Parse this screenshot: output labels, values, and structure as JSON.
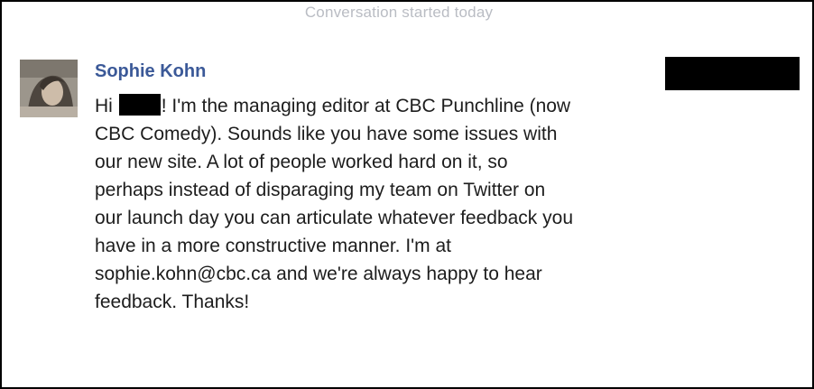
{
  "conversation": {
    "header": "Conversation started today"
  },
  "message": {
    "sender": "Sophie Kohn",
    "greeting": "Hi",
    "lines": {
      "l1_rest": "! I'm the managing editor at CBC Punchline (now",
      "l2": "CBC Comedy). Sounds like you have some issues with",
      "l3": "our new site. A lot of people worked hard on it, so",
      "l4": "perhaps instead of disparaging my team on Twitter on",
      "l5": "our launch day you can articulate whatever feedback you",
      "l6": "have in a more constructive manner. I'm at",
      "l7": "sophie.kohn@cbc.ca and we're always happy to hear",
      "l8": "feedback. Thanks!"
    }
  },
  "colors": {
    "sender_name": "#3b5998",
    "header_text": "#b9bcc3",
    "message_text": "#1d1d1d",
    "redaction": "#000000"
  },
  "icons": {
    "avatar": "profile-photo"
  }
}
